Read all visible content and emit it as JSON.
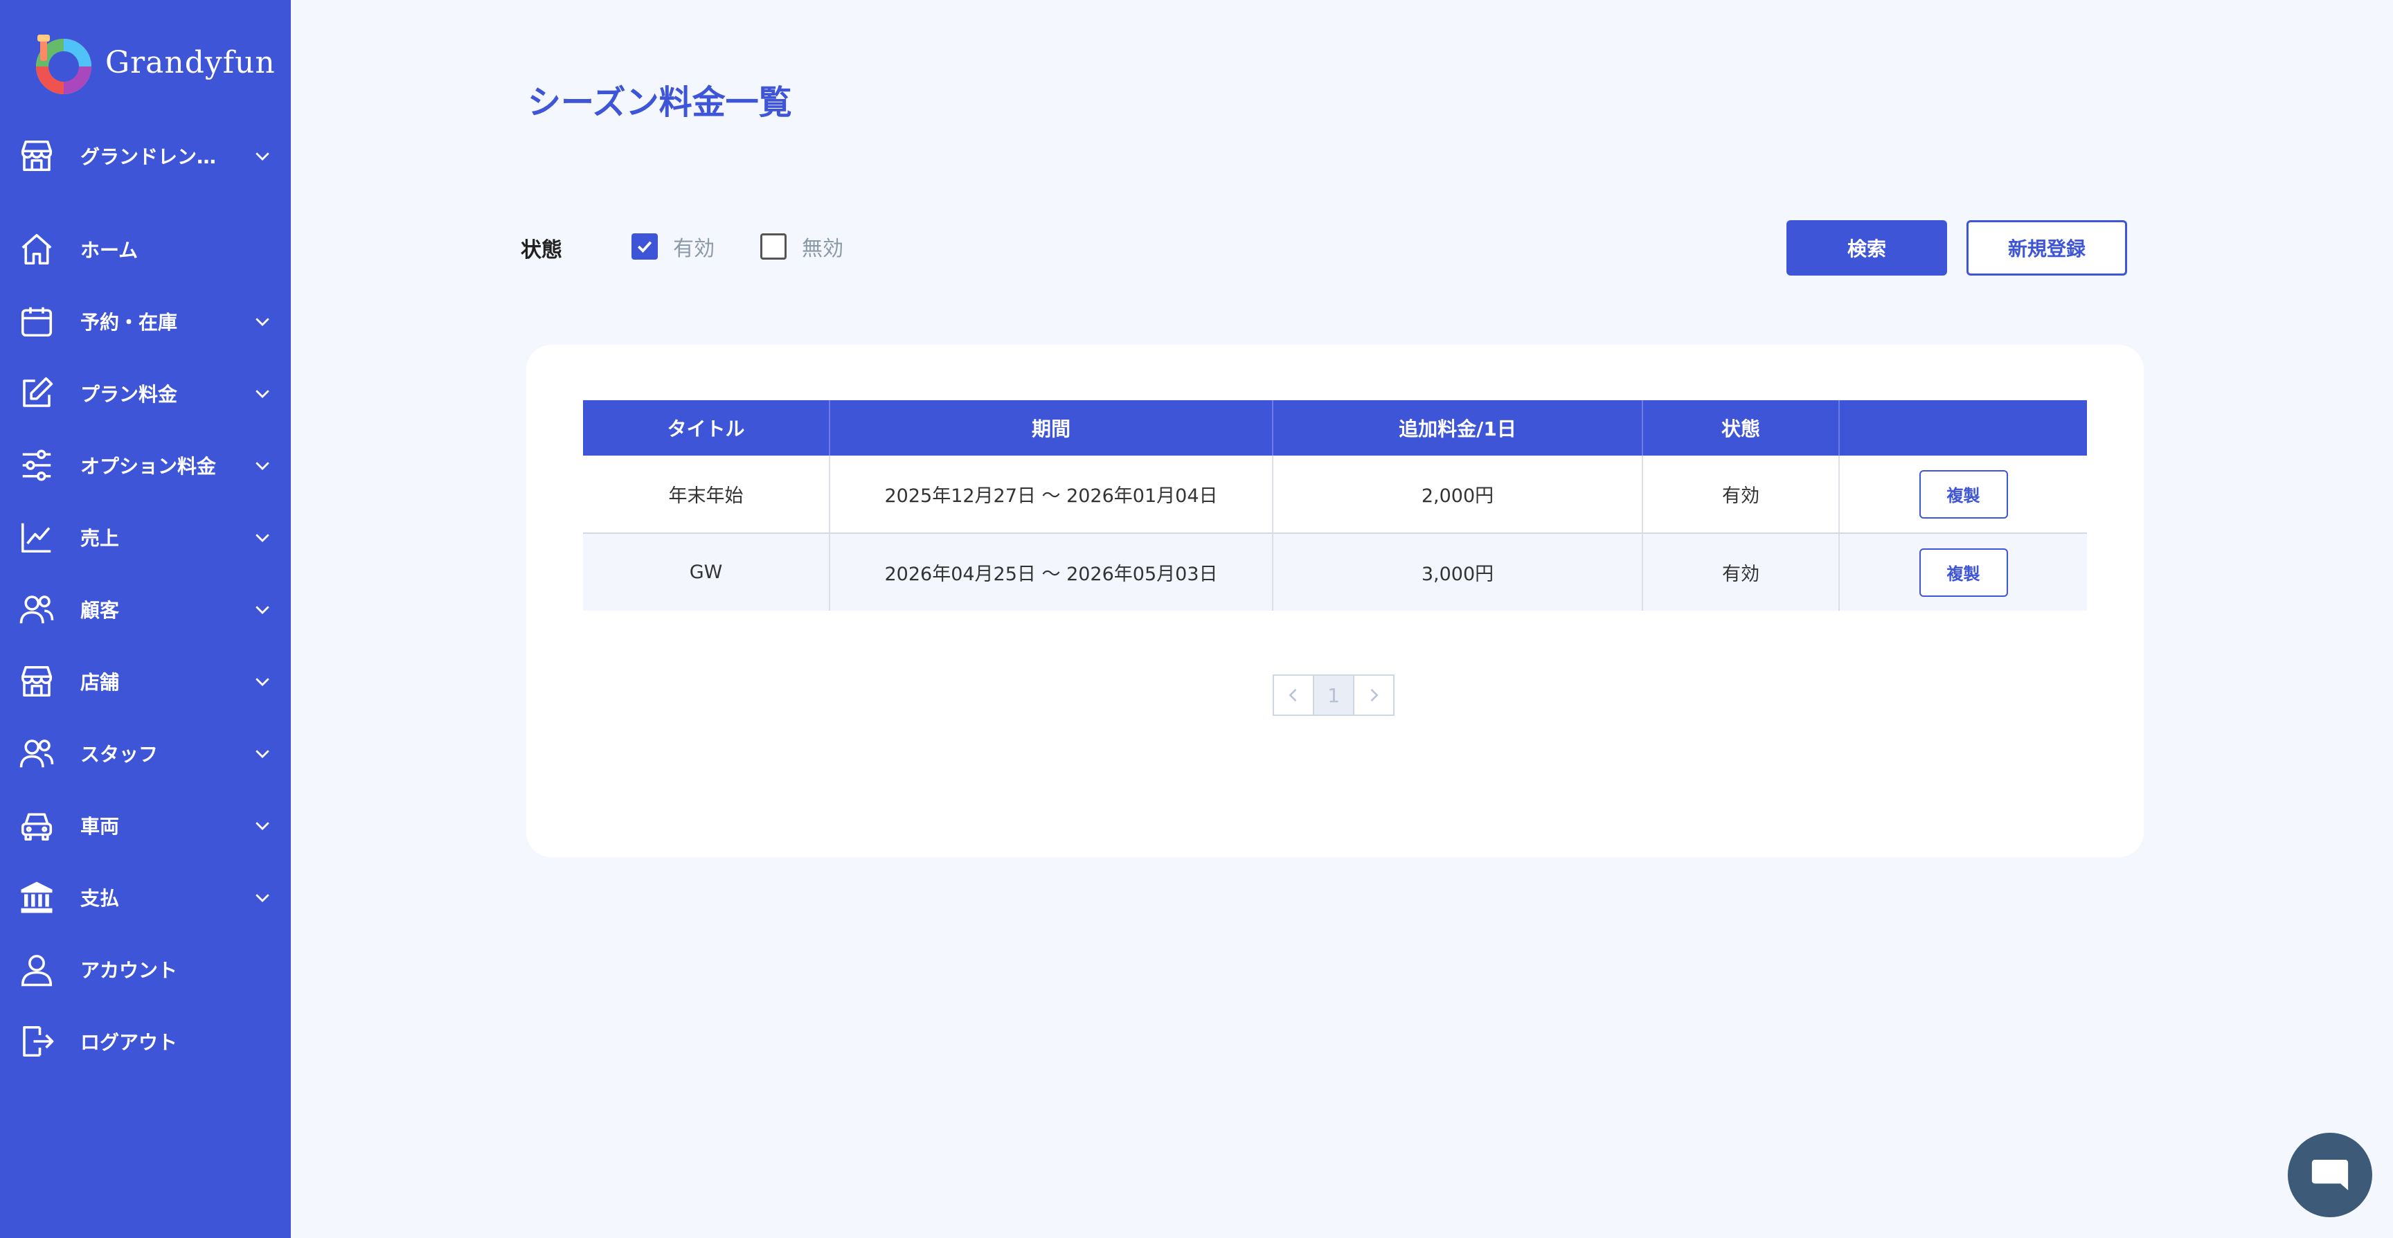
{
  "app": {
    "logo_text": "Grandyfun",
    "store_name": "グランドレン…"
  },
  "sidebar": {
    "items": [
      {
        "label": "ホーム",
        "icon": "home-icon",
        "has_submenu": false
      },
      {
        "label": "予約・在庫",
        "icon": "calendar-icon",
        "has_submenu": true
      },
      {
        "label": "プラン料金",
        "icon": "edit-icon",
        "has_submenu": true
      },
      {
        "label": "オプション料金",
        "icon": "sliders-icon",
        "has_submenu": true
      },
      {
        "label": "売上",
        "icon": "chart-line-icon",
        "has_submenu": true
      },
      {
        "label": "顧客",
        "icon": "users-icon",
        "has_submenu": true
      },
      {
        "label": "店舗",
        "icon": "store-icon",
        "has_submenu": true
      },
      {
        "label": "スタッフ",
        "icon": "staff-icon",
        "has_submenu": true
      },
      {
        "label": "車両",
        "icon": "car-icon",
        "has_submenu": true
      },
      {
        "label": "支払",
        "icon": "bank-icon",
        "has_submenu": true
      },
      {
        "label": "アカウント",
        "icon": "user-icon",
        "has_submenu": false
      },
      {
        "label": "ログアウト",
        "icon": "logout-icon",
        "has_submenu": false
      }
    ]
  },
  "page": {
    "title": "シーズン料金一覧"
  },
  "filter": {
    "label": "状態",
    "options": [
      {
        "label": "有効",
        "checked": true
      },
      {
        "label": "無効",
        "checked": false
      }
    ],
    "search_label": "検索",
    "new_label": "新規登録"
  },
  "table": {
    "headers": [
      "タイトル",
      "期間",
      "追加料金/1日",
      "状態",
      ""
    ],
    "rows": [
      {
        "title": "年末年始",
        "period": "2025年12月27日 〜 2026年01月04日",
        "fee": "2,000円",
        "status": "有効",
        "action": "複製"
      },
      {
        "title": "GW",
        "period": "2026年04月25日 〜 2026年05月03日",
        "fee": "3,000円",
        "status": "有効",
        "action": "複製"
      }
    ]
  },
  "pagination": {
    "current": "1",
    "prev_icon": "chevron-left-icon",
    "next_icon": "chevron-right-icon"
  },
  "colors": {
    "primary": "#3f55d8",
    "background": "#f4f7fd",
    "chat": "#3e5a79"
  }
}
